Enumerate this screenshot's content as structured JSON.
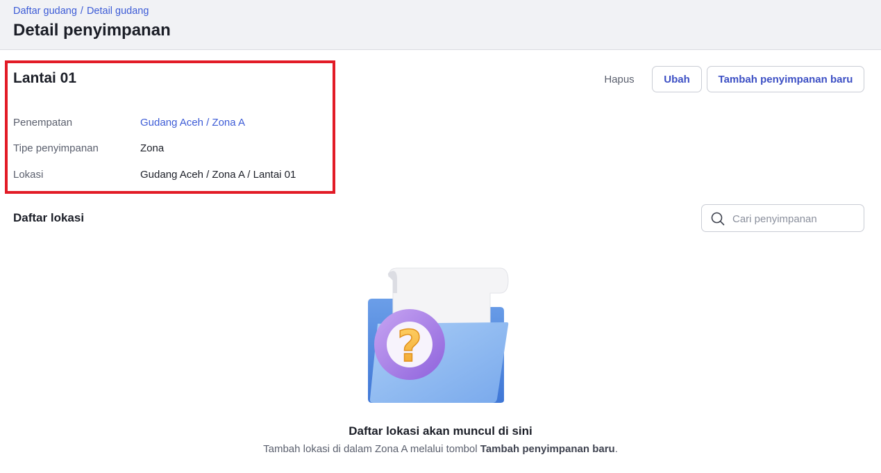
{
  "header": {
    "breadcrumb": [
      "Daftar gudang",
      "Detail gudang"
    ],
    "breadcrumb_separator": "/",
    "title": "Detail penyimpanan"
  },
  "detail": {
    "name": "Lantai 01",
    "rows": [
      {
        "label": "Penempatan",
        "value": "Gudang Aceh / Zona A"
      },
      {
        "label": "Tipe penyimpanan",
        "value": "Zona"
      },
      {
        "label": "Lokasi",
        "value": "Gudang Aceh / Zona A / Lantai 01"
      }
    ],
    "highlight_color": "#e21b26"
  },
  "actions": {
    "delete_label": "Hapus",
    "edit_label": "Ubah",
    "add_label": "Tambah penyimpanan baru"
  },
  "locations": {
    "title": "Daftar lokasi",
    "search": {
      "placeholder": "Cari penyimpanan",
      "value": "",
      "icon": "search-icon"
    }
  },
  "empty_state": {
    "illustration": "folder-question-icon",
    "title": "Daftar lokasi akan muncul di sini",
    "description_prefix": "Tambah lokasi di dalam Zona A melalui tombol ",
    "description_bold": "Tambah penyimpanan baru",
    "description_suffix": "."
  },
  "colors": {
    "accent": "#3c5bd6",
    "header_bg": "#f1f2f5"
  }
}
